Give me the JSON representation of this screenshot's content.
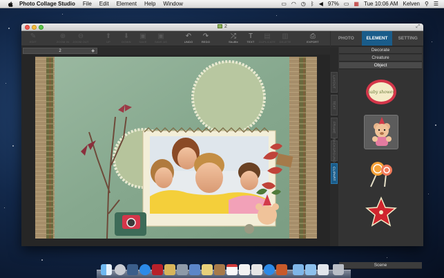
{
  "menubar": {
    "app_name": "Photo Collage Studio",
    "items": [
      "File",
      "Edit",
      "Element",
      "Help",
      "Window"
    ],
    "battery": "97%",
    "clock": "Tue 10:06 AM",
    "user": "Kelven"
  },
  "window": {
    "title": "2"
  },
  "toolbar": {
    "buttons": [
      {
        "label": "EDIT",
        "glyph": "✎",
        "enabled": false
      },
      {
        "label": "ZOOM IN",
        "glyph": "⊕",
        "enabled": false
      },
      {
        "label": "ZOOM OUT",
        "glyph": "⊖",
        "enabled": false
      },
      {
        "label": "UP",
        "glyph": "⬆",
        "enabled": false
      },
      {
        "label": "DOWN",
        "glyph": "⬇",
        "enabled": false
      },
      {
        "label": "SAVE",
        "glyph": "▣",
        "enabled": false
      },
      {
        "label": "SAVE AS",
        "glyph": "▣",
        "enabled": false
      },
      {
        "label": "UNDO",
        "glyph": "↶",
        "enabled": true
      },
      {
        "label": "REDO",
        "glyph": "↷",
        "enabled": true
      },
      {
        "label": "Shuffle",
        "glyph": "⤮",
        "enabled": true
      },
      {
        "label": "TEXT",
        "glyph": "T",
        "enabled": true
      },
      {
        "label": "DUPLICATE",
        "glyph": "▤",
        "enabled": false
      },
      {
        "label": "DELETE",
        "glyph": "▥",
        "enabled": false
      },
      {
        "label": "EXPORT",
        "glyph": "⎙",
        "enabled": true
      }
    ]
  },
  "right_tabs": {
    "photo": "PHOTO",
    "element": "ELEMENT",
    "setting": "SETTING"
  },
  "doc_tab": {
    "label": "2",
    "close": "◆"
  },
  "side_tabs": [
    "LAYOUT",
    "TEXT",
    "FRAME",
    "BACKGROUND",
    "CLIPART"
  ],
  "panel": {
    "categories": [
      "Decorate",
      "Creature",
      "Object"
    ],
    "selected_category": "Object",
    "thumb_text": "baby shower",
    "bottom_category": "Scene"
  },
  "colors": {
    "accent": "#1a5c8a",
    "paper_green": "#8fb09a"
  }
}
